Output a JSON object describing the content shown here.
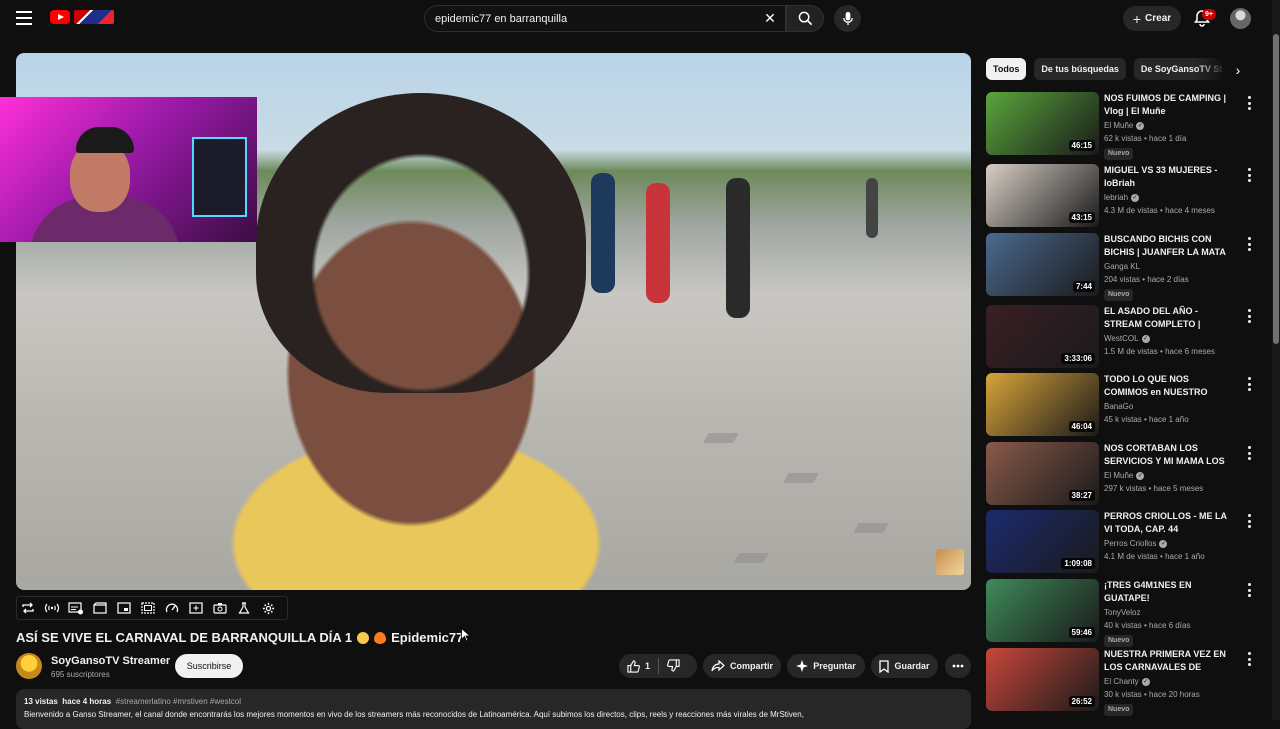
{
  "header": {
    "search_value": "epidemic77 en barranquilla",
    "create_label": "Crear",
    "notifications_badge": "9+"
  },
  "video": {
    "title": "ASÍ SE VIVE EL CARNAVAL DE BARRANQUILLA DÍA 1",
    "title_suffix": "Epidemic77",
    "channel_name": "SoyGansoTV Streamer",
    "subscribers": "695 suscriptores",
    "subscribe_label": "Suscribirse",
    "likes": "1",
    "share_label": "Compartir",
    "ask_label": "Preguntar",
    "save_label": "Guardar"
  },
  "description": {
    "views": "13 vistas",
    "time": "hace 4 horas",
    "hashtags": "#streamerlatino #mrstiven #westcol",
    "text": "Bienvenido a Ganso Streamer, el canal donde encontrarás los mejores momentos en vivo de los streamers más reconocidos de Latinoamérica. Aquí subimos los directos, clips, reels y reacciones más virales de MrStiven,"
  },
  "chips": [
    "Todos",
    "De tus búsquedas",
    "De SoyGansoTV Streamer"
  ],
  "related": [
    {
      "title": "NOS FUIMOS DE CAMPING | Vlog | El Muñe",
      "channel": "El Muñe",
      "verified": true,
      "views": "62 k vistas",
      "age": "hace 1 día",
      "badge": "Nuevo",
      "duration": "46:15",
      "thumb_color": "#5aa63c"
    },
    {
      "title": "MIGUEL VS 33 MUJERES - loBriah",
      "channel": "lebriah",
      "verified": true,
      "views": "4.3 M de vistas",
      "age": "hace 4 meses",
      "badge": "",
      "duration": "43:15",
      "thumb_color": "#d8cfc6"
    },
    {
      "title": "BUSCANDO BICHIS CON BICHIS | JUANFER LA MATA",
      "channel": "Ganga KL",
      "verified": false,
      "views": "204 vistas",
      "age": "hace 2 días",
      "badge": "Nuevo",
      "duration": "7:44",
      "thumb_color": "#4b6a8e"
    },
    {
      "title": "EL ASADO DEL AÑO - STREAM COMPLETO | WESTCOL",
      "channel": "WestCOL",
      "verified": true,
      "views": "1.5 M de vistas",
      "age": "hace 6 meses",
      "badge": "",
      "duration": "3:33:06",
      "thumb_color": "#3a1f25"
    },
    {
      "title": "TODO LO QUE NOS COMIMOS en NUESTRO PASO por ...",
      "channel": "BanaGo",
      "verified": false,
      "views": "45 k vistas",
      "age": "hace 1 año",
      "badge": "",
      "duration": "46:04",
      "thumb_color": "#d9a43a"
    },
    {
      "title": "NOS CORTABAN LOS SERVICIOS Y MI MAMA LOS ...",
      "channel": "El Muñe",
      "verified": true,
      "views": "297 k vistas",
      "age": "hace 5 meses",
      "badge": "",
      "duration": "38:27",
      "thumb_color": "#8a5a4a"
    },
    {
      "title": "PERROS CRIOLLOS - ME LA VI TODA, CAP. 44",
      "channel": "Perros Criollos",
      "verified": true,
      "views": "4.1 M de vistas",
      "age": "hace 1 año",
      "badge": "",
      "duration": "1:09:08",
      "thumb_color": "#1c2a6e"
    },
    {
      "title": "¡TRES G4M1NES EN GUATAPE!",
      "channel": "TonyVeloz",
      "verified": false,
      "views": "40 k vistas",
      "age": "hace 6 días",
      "badge": "Nuevo",
      "duration": "59:46",
      "thumb_color": "#3f8a5a"
    },
    {
      "title": "NUESTRA PRIMERA VEZ EN LOS CARNAVALES DE BRASIL",
      "channel": "El Chanty",
      "verified": true,
      "views": "30 k vistas",
      "age": "hace 20 horas",
      "badge": "Nuevo",
      "duration": "26:52",
      "thumb_color": "#c8463a"
    }
  ],
  "colors": {
    "background": "#0f0f0f",
    "accent_red": "#ff0000",
    "chip_active": "#f1f1f1"
  }
}
